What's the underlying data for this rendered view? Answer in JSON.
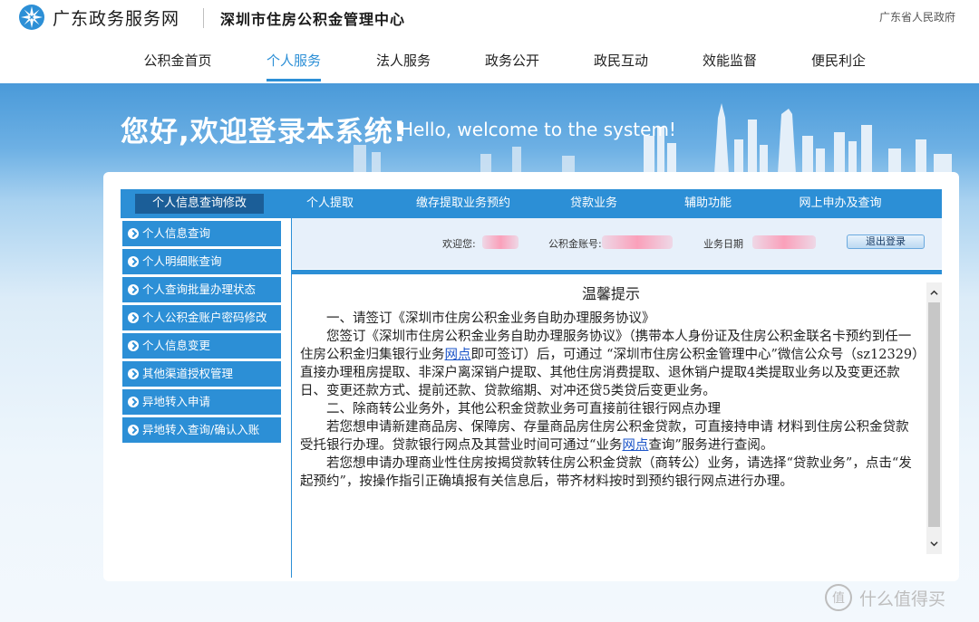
{
  "header": {
    "site_name": "广东政务服务网",
    "center_name": "深圳市住房公积金管理中心",
    "gov_link": "广东省人民政府"
  },
  "main_nav": [
    "公积金首页",
    "个人服务",
    "法人服务",
    "政务公开",
    "政民互动",
    "效能监督",
    "便民利企"
  ],
  "main_nav_active": "个人服务",
  "banner": {
    "welcome_cn": "您好,欢迎登录本系统!",
    "welcome_en": "Hello, welcome to the system!"
  },
  "sub_nav": [
    "个人信息查询修改",
    "个人提取",
    "缴存提取业务预约",
    "贷款业务",
    "辅助功能",
    "网上申办及查询"
  ],
  "sidebar": [
    "个人信息查询",
    "个人明细账查询",
    "个人查询批量办理状态",
    "个人公积金账户密码修改",
    "个人信息变更",
    "其他渠道授权管理",
    "异地转入申请",
    "异地转入查询/确认入账"
  ],
  "infobar": {
    "welcome_label": "欢迎您:",
    "account_label": "公积金账号:",
    "date_label": "业务日期",
    "logout": "退出登录"
  },
  "notice": {
    "title": "温馨提示",
    "p1_line": "一、请签订《深圳市住房公积金业务自助办理服务协议》",
    "p2_a": "您签订《深圳市住房公积金业务自助办理服务协议》（携带本人身份证及住房公积金联名卡预约到任一住房公积金归集银行业务",
    "p2_link": "网点",
    "p2_b": "即可签订）后，可通过 “深圳市住房公积金管理中心”微信公众号（sz12329）直接办理租房提取、非深户离深销户提取、其他住房消费提取、退休销户提取4类提取业务以及变更还款日、变更还款方式、提前还款、贷款缩期、对冲还贷5类贷后变更业务。",
    "p3": "二、除商转公业务外，其他公积金贷款业务可直接前往银行网点办理",
    "p4_a": "若您想申请新建商品房、保障房、存量商品房住房公积金贷款，可直接持申请 材料到住房公积金贷款受托银行办理。贷款银行网点及其营业时间可通过“业务",
    "p4_link": "网点",
    "p4_b": "查询”服务进行查阅。",
    "p5": "若您想申请办理商业性住房按揭贷款转住房公积金贷款（商转公）业务，请选择“贷款业务”，点击“发起预约”，按操作指引正确填报有关信息后，带齐材料按时到预约银行网点进行办理。"
  },
  "watermark": {
    "badge": "值",
    "text": "什么值得买"
  },
  "colors": {
    "primary": "#2c8fd6",
    "active_tab": "#1b5e98",
    "link": "#1b54c8"
  }
}
